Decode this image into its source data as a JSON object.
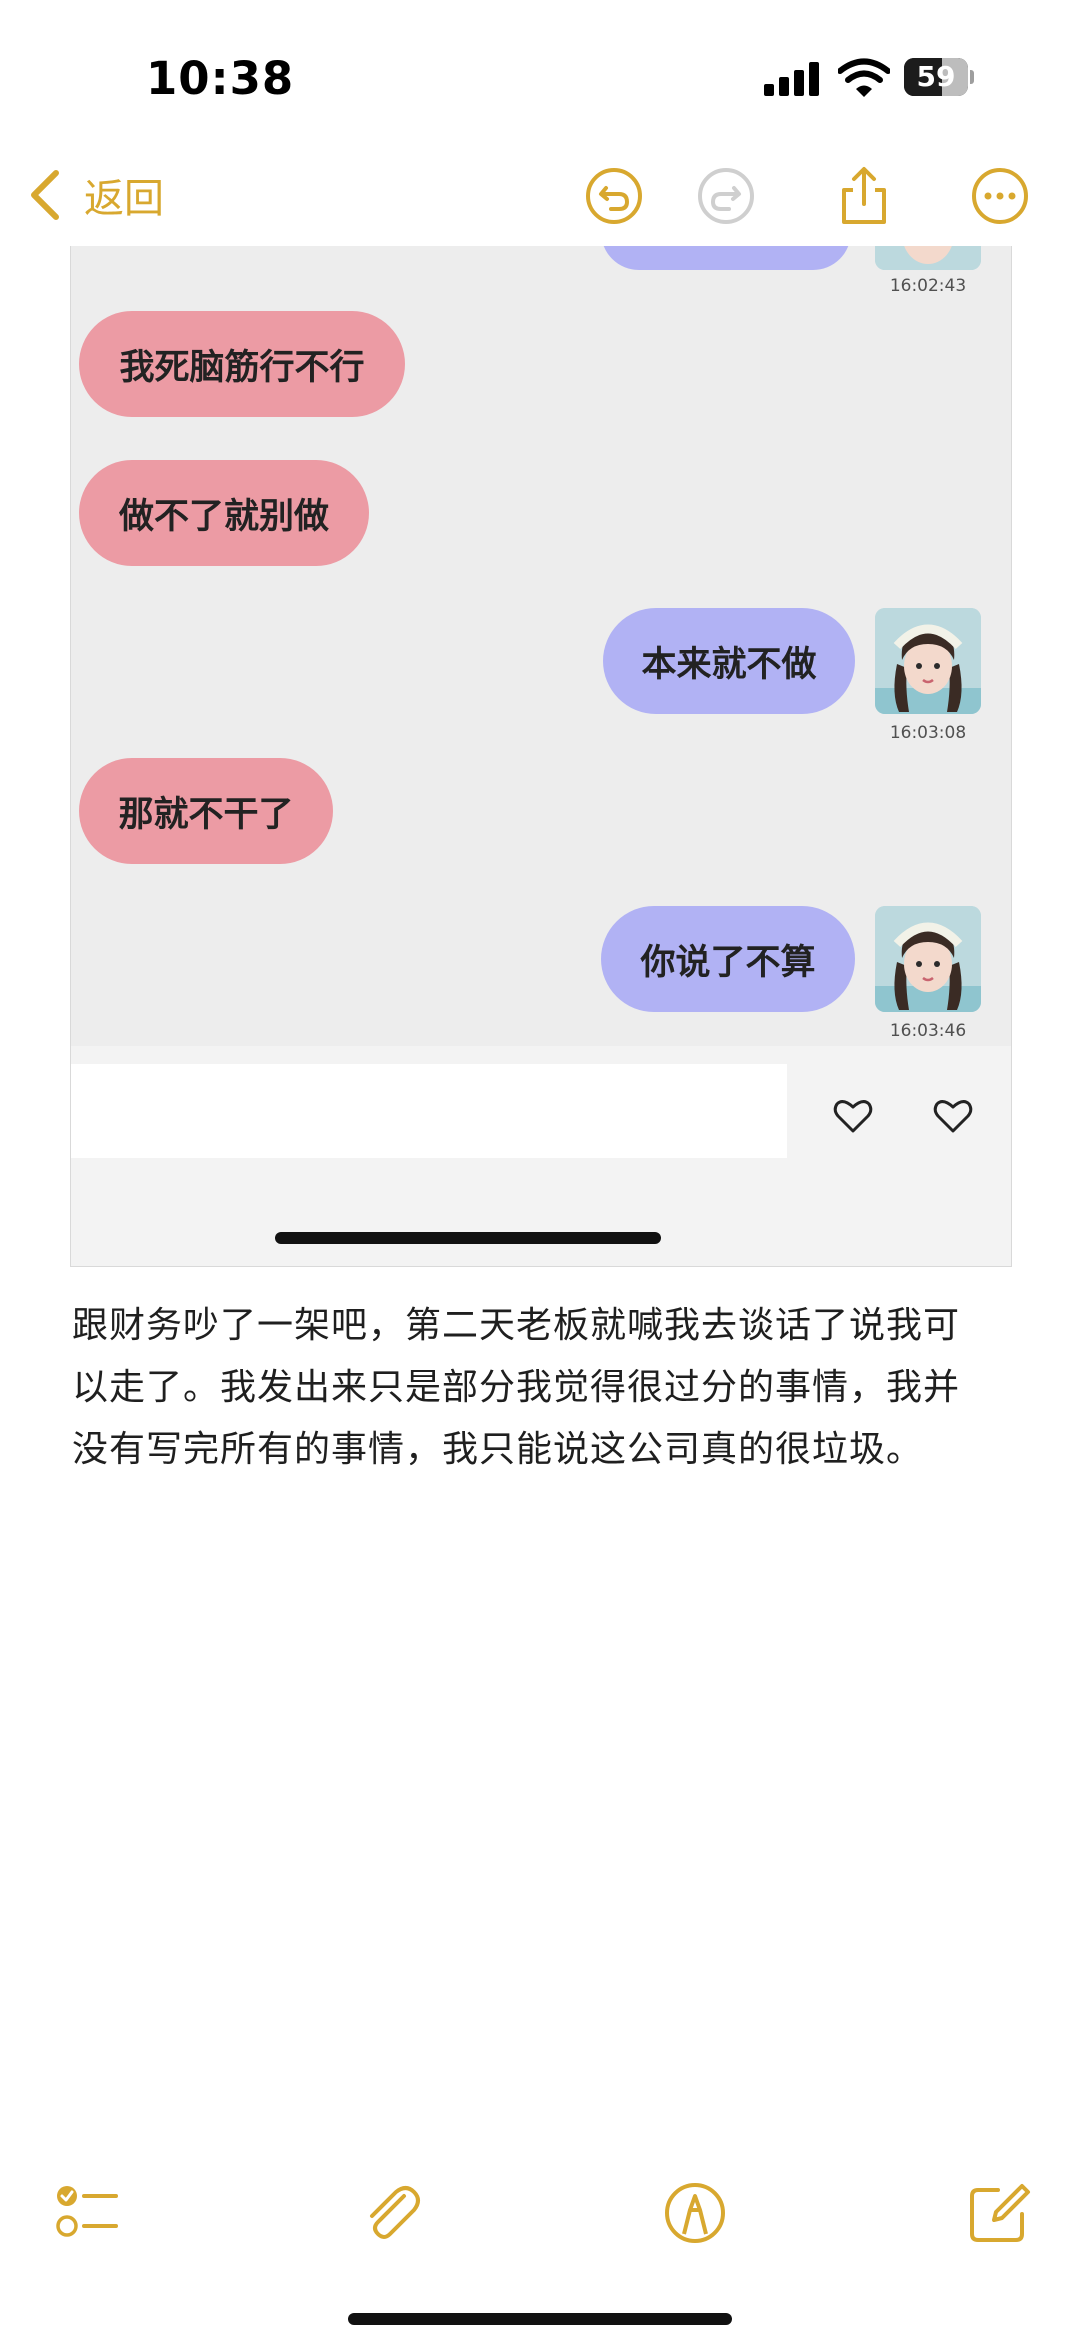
{
  "status_bar": {
    "time": "10:38",
    "battery_level": "59",
    "battery_fraction": 0.59
  },
  "nav": {
    "back_label": "返回",
    "icons": [
      "chevron-left-icon",
      "undo-icon",
      "redo-icon",
      "share-icon",
      "more-icon"
    ]
  },
  "chat": {
    "messages": [
      {
        "side": "right",
        "text": "",
        "time": "16:02:43"
      },
      {
        "side": "left",
        "text": "我死脑筋行不行"
      },
      {
        "side": "left",
        "text": "做不了就别做"
      },
      {
        "side": "right",
        "text": "本来就不做",
        "time": "16:03:08"
      },
      {
        "side": "left",
        "text": "那就不干了"
      },
      {
        "side": "right",
        "text": "你说了不算",
        "time": "16:03:46"
      }
    ],
    "input_icons": [
      "heart-icon",
      "heart-icon"
    ]
  },
  "note": {
    "line1": "跟财务吵了一架吧，第二天老板就喊我去谈话了说我可",
    "line2": "以走了。我发出来只是部分我觉得很过分的事情，我并",
    "line3": "没有写完所有的事情，我只能说这公司真的很垃圾。"
  },
  "toolbar": {
    "icons": [
      "checklist-icon",
      "attachment-icon",
      "markup-icon",
      "compose-icon"
    ]
  },
  "colors": {
    "accent": "#d8a82f",
    "left_bubble": "#ec9ba4",
    "right_bubble": "#b1b2f4",
    "chat_bg": "#ededed"
  }
}
